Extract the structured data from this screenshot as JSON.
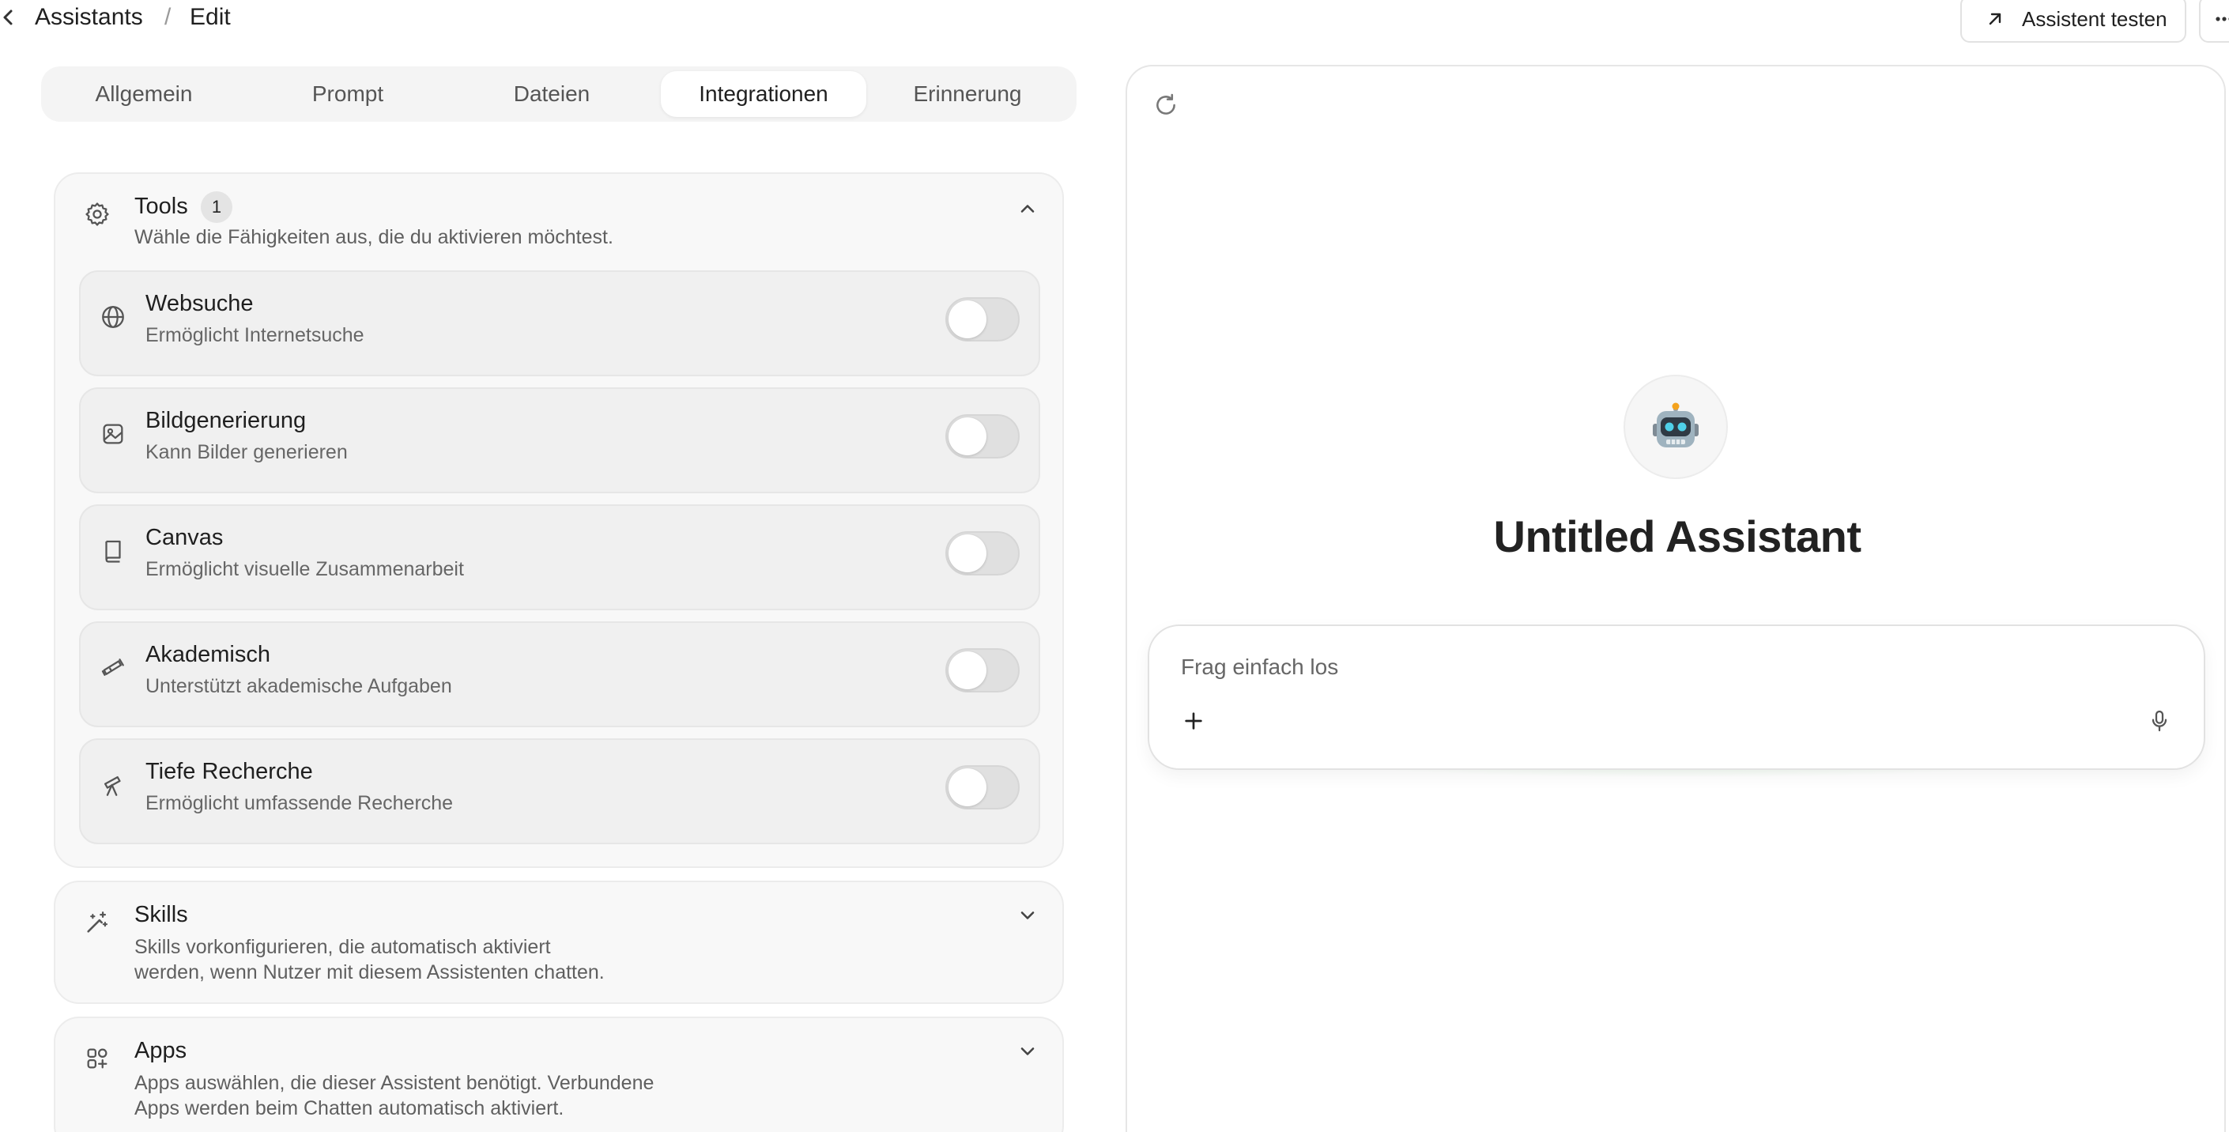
{
  "header": {
    "back_icon": "chevron-left-icon",
    "breadcrumb_root": "Assistants",
    "breadcrumb_separator": "/",
    "breadcrumb_current": "Edit",
    "test_button_icon": "arrow-up-right-icon",
    "test_button_label": "Assistent testen",
    "more_icon": "more-horizontal-icon"
  },
  "tabs": [
    {
      "label": "Allgemein",
      "active": false
    },
    {
      "label": "Prompt",
      "active": false
    },
    {
      "label": "Dateien",
      "active": false
    },
    {
      "label": "Integrationen",
      "active": true
    },
    {
      "label": "Erinnerung",
      "active": false
    }
  ],
  "tools": {
    "icon": "gear-icon",
    "title": "Tools",
    "badge": "1",
    "description": "Wähle die Fähigkeiten aus, die du aktivieren möchtest.",
    "expanded": true,
    "items": [
      {
        "icon": "globe-icon",
        "name": "Websuche",
        "description": "Ermöglicht Internetsuche",
        "enabled": false
      },
      {
        "icon": "image-icon",
        "name": "Bildgenerierung",
        "description": "Kann Bilder generieren",
        "enabled": false
      },
      {
        "icon": "book-icon",
        "name": "Canvas",
        "description": "Ermöglicht visuelle Zusammenarbeit",
        "enabled": false
      },
      {
        "icon": "telescope-icon",
        "name": "Akademisch",
        "description": "Unterstützt akademische Aufgaben",
        "enabled": false
      },
      {
        "icon": "telescope-tripod-icon",
        "name": "Tiefe Recherche",
        "description": "Ermöglicht umfassende Recherche",
        "enabled": false
      }
    ]
  },
  "skills": {
    "icon": "magic-wand-icon",
    "title": "Skills",
    "description_line1": "Skills vorkonfigurieren, die automatisch aktiviert",
    "description_line2": "werden, wenn Nutzer mit diesem Assistenten chatten.",
    "expanded": false
  },
  "apps": {
    "icon": "apps-grid-icon",
    "title": "Apps",
    "description_line1": "Apps auswählen, die dieser Assistent benötigt. Verbundene",
    "description_line2": "Apps werden beim Chatten automatisch aktiviert.",
    "expanded": false
  },
  "preview": {
    "refresh_icon": "refresh-icon",
    "avatar_icon": "robot-icon",
    "avatar_emoji": "🤖",
    "assistant_name": "Untitled Assistant",
    "input_placeholder": "Frag einfach los",
    "plus_icon": "plus-icon",
    "mic_icon": "microphone-icon"
  }
}
